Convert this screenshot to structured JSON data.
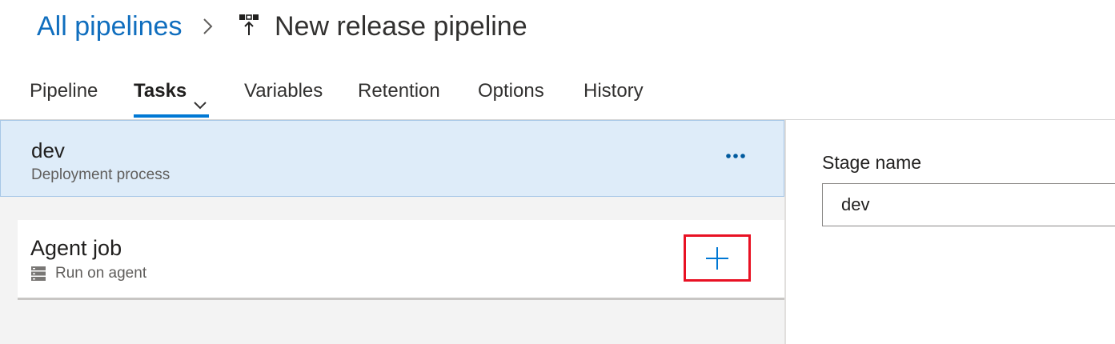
{
  "breadcrumb": {
    "root_label": "All pipelines",
    "separator_icon": "chevron-right-icon",
    "pipeline_icon": "release-pipeline-icon",
    "title": "New release pipeline"
  },
  "tabs": [
    {
      "label": "Pipeline",
      "active": false
    },
    {
      "label": "Tasks",
      "active": true,
      "dropdown_icon": "chevron-down-icon"
    },
    {
      "label": "Variables",
      "active": false
    },
    {
      "label": "Retention",
      "active": false
    },
    {
      "label": "Options",
      "active": false
    },
    {
      "label": "History",
      "active": false
    }
  ],
  "stage": {
    "name": "dev",
    "subtitle": "Deployment process",
    "more_icon": "more-actions-icon"
  },
  "agent_job": {
    "name": "Agent job",
    "subtitle": "Run on agent",
    "subtitle_icon": "server-icon",
    "add_icon": "plus-icon"
  },
  "properties": {
    "stage_name_label": "Stage name",
    "stage_name_value": "dev"
  },
  "colors": {
    "accent": "#0078d4",
    "link": "#106ebe",
    "selected_stage_bg": "#deecf9",
    "highlight_box": "#e81123"
  }
}
